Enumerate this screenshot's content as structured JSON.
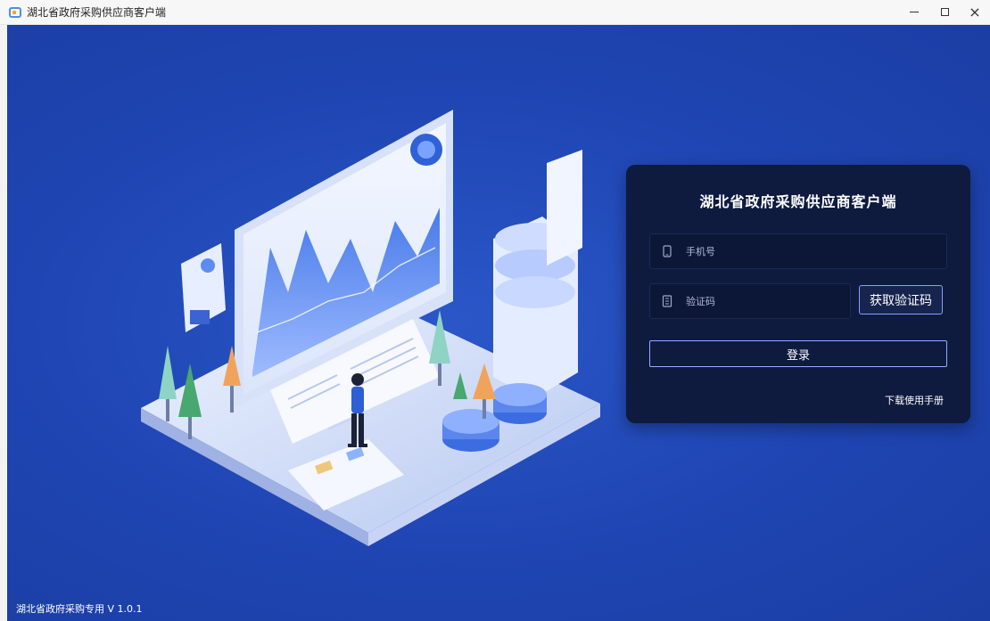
{
  "window": {
    "title": "湖北省政府采购供应商客户端",
    "controls": {
      "minimize": "−",
      "maximize": "□",
      "close": "×"
    }
  },
  "login": {
    "title": "湖北省政府采购供应商客户端",
    "phone_placeholder": "手机号",
    "code_placeholder": "验证码",
    "get_code_label": "获取验证码",
    "login_label": "登录",
    "manual_link": "下载使用手册"
  },
  "footer": {
    "version_text": "湖北省政府采购专用 V 1.0.1"
  },
  "icons": {
    "app": "app-icon",
    "phone": "phone-icon",
    "code": "document-icon"
  },
  "colors": {
    "background": "#1f45b3",
    "card": "#0f1a3f",
    "accent": "#8fb0ff"
  }
}
